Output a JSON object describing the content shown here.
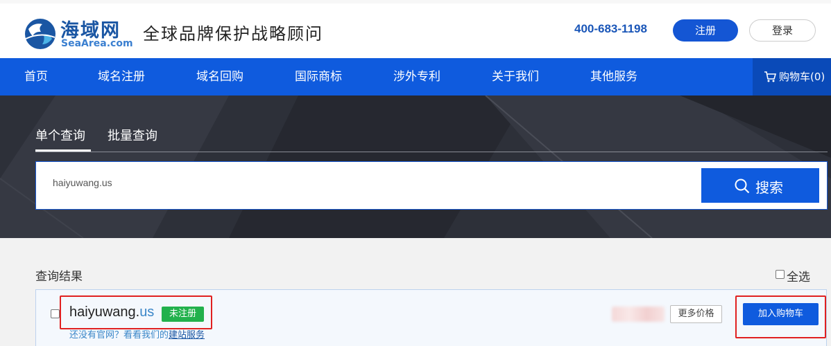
{
  "header": {
    "logo_cn": "海域网",
    "logo_en": "SeaArea.com",
    "slogan": "全球品牌保护战略顾问",
    "phone": "400-683-1198",
    "register_label": "注册",
    "login_label": "登录"
  },
  "nav": {
    "items": [
      "首页",
      "域名注册",
      "域名回购",
      "国际商标",
      "涉外专利",
      "关于我们",
      "其他服务"
    ],
    "cart_label": "购物车(0)"
  },
  "search": {
    "tabs": [
      "单个查询",
      "批量查询"
    ],
    "active_tab": "单个查询",
    "value": "haiyuwang.us",
    "button_label": "搜索"
  },
  "results": {
    "title": "查询结果",
    "select_all_label": "全选",
    "items": [
      {
        "domain_name": "haiyuwang.",
        "tld": "us",
        "status": "未注册",
        "note_text": "还没有官网？看看我们的",
        "note_link": "建站服务",
        "more_price_label": "更多价格",
        "add_cart_label": "加入购物车"
      }
    ]
  },
  "colors": {
    "brand_blue": "#0f5bde",
    "status_green": "#22b14c",
    "highlight_red": "#e02020"
  }
}
